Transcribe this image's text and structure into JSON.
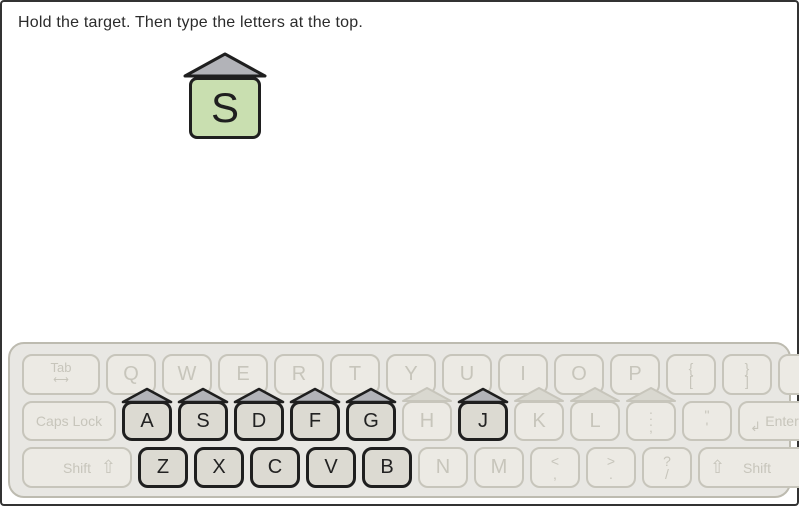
{
  "instruction": "Hold the target. Then type the letters at the top.",
  "target": {
    "letter": "S"
  },
  "keyboard": {
    "row1": {
      "tab": "Tab",
      "keys": [
        "Q",
        "W",
        "E",
        "R",
        "T",
        "Y",
        "U",
        "I",
        "O",
        "P"
      ],
      "br1": {
        "top": "{",
        "bot": "["
      },
      "br2": {
        "top": "}",
        "bot": "]"
      },
      "bs": {
        "top": "|",
        "bot": "\\"
      }
    },
    "row2": {
      "caps": "Caps Lock",
      "keys": [
        "A",
        "S",
        "D",
        "F",
        "G",
        "H",
        "J",
        "K",
        "L"
      ],
      "home": [
        "A",
        "S",
        "D",
        "F",
        "G",
        "H",
        "J",
        "K",
        "L"
      ],
      "active": [
        "A",
        "S",
        "D",
        "F",
        "G",
        "J"
      ],
      "sc": {
        "top": ":",
        "bot": ";"
      },
      "qt": {
        "top": "\"",
        "bot": "'"
      },
      "enter": "Enter"
    },
    "row3": {
      "shiftL": "Shift",
      "keys": [
        "Z",
        "X",
        "C",
        "V",
        "B",
        "N",
        "M"
      ],
      "active": [
        "Z",
        "X",
        "C",
        "V",
        "B"
      ],
      "cm": {
        "top": "<",
        "bot": ","
      },
      "pd": {
        "top": ">",
        "bot": "."
      },
      "sl": {
        "top": "?",
        "bot": "/"
      },
      "shiftR": "Shift"
    }
  }
}
